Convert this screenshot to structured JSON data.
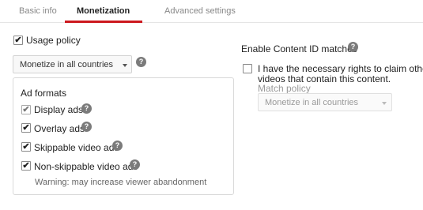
{
  "tabs": [
    {
      "label": "Basic info"
    },
    {
      "label": "Monetization"
    },
    {
      "label": "Advanced settings"
    }
  ],
  "usage_policy": {
    "label": "Usage policy",
    "checked": true,
    "select_value": "Monetize in all countries"
  },
  "ad_formats": {
    "heading": "Ad formats",
    "items": [
      {
        "label": "Display ads",
        "checked": true
      },
      {
        "label": "Overlay ads",
        "checked": true
      },
      {
        "label": "Skippable video ads",
        "checked": true
      },
      {
        "label": "Non-skippable video ads",
        "checked": true
      }
    ],
    "warning": "Warning: may increase viewer abandonment"
  },
  "content_id": {
    "heading": "Enable Content ID matches",
    "rights_line1": "I have the necessary rights to claim other",
    "rights_line2": "videos that contain this content.",
    "rights_checked": false,
    "match_policy_label": "Match policy",
    "match_policy_value": "Monetize in all countries"
  },
  "icons": {
    "help": "?",
    "check": "✔"
  },
  "colors": {
    "accent": "#cc181e",
    "help_icon": "#7b7b7b"
  }
}
